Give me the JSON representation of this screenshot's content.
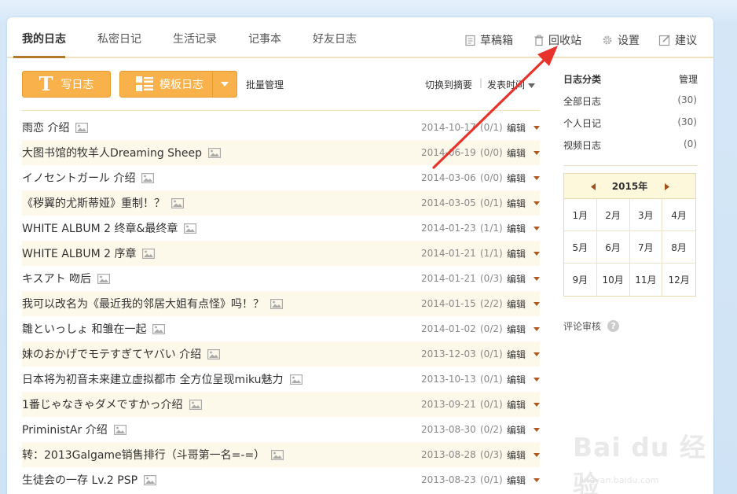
{
  "tabs": [
    {
      "label": "我的日志",
      "active": true
    },
    {
      "label": "私密日记"
    },
    {
      "label": "生活记录"
    },
    {
      "label": "记事本"
    },
    {
      "label": "好友日志"
    }
  ],
  "tools": {
    "drafts": "草稿箱",
    "recycle": "回收站",
    "settings": "设置",
    "suggest": "建议"
  },
  "actions": {
    "write": "写日志",
    "template": "模板日志",
    "batch": "批量管理",
    "switch_view": "切换到摘要",
    "separator": "|",
    "sort": "发表时间"
  },
  "entries": [
    {
      "title": "雨恋 介绍",
      "date": "2014-10-17",
      "count": "(0/1)",
      "edit": "编辑"
    },
    {
      "title": "大图书馆的牧羊人Dreaming Sheep",
      "date": "2014-06-19",
      "count": "(0/0)",
      "edit": "编辑"
    },
    {
      "title": "イノセントガール 介绍",
      "date": "2014-03-06",
      "count": "(0/0)",
      "edit": "编辑"
    },
    {
      "title": "《秽翼的尤斯蒂娅》重制！？",
      "date": "2014-03-05",
      "count": "(0/1)",
      "edit": "编辑"
    },
    {
      "title": "WHITE ALBUM 2 终章&最终章",
      "date": "2014-01-23",
      "count": "(1/1)",
      "edit": "编辑"
    },
    {
      "title": "WHITE ALBUM 2 序章",
      "date": "2014-01-21",
      "count": "(1/1)",
      "edit": "编辑"
    },
    {
      "title": "キスアト 吻后",
      "date": "2014-01-21",
      "count": "(0/3)",
      "edit": "编辑"
    },
    {
      "title": "我可以改名为《最近我的邻居大姐有点怪》吗！？",
      "date": "2014-01-15",
      "count": "(2/2)",
      "edit": "编辑"
    },
    {
      "title": "雛といっしょ 和雏在一起",
      "date": "2014-01-02",
      "count": "(0/2)",
      "edit": "编辑"
    },
    {
      "title": "妹のおかげでモテすぎてヤバい 介绍",
      "date": "2013-12-03",
      "count": "(0/1)",
      "edit": "编辑"
    },
    {
      "title": "日本将为初音未来建立虚拟都市 全方位呈现miku魅力",
      "date": "2013-10-13",
      "count": "(0/1)",
      "edit": "编辑"
    },
    {
      "title": "1番じゃなきゃダメですかっ介绍",
      "date": "2013-09-21",
      "count": "(0/1)",
      "edit": "编辑"
    },
    {
      "title": "PriministAr 介绍",
      "date": "2013-08-30",
      "count": "(0/2)",
      "edit": "编辑"
    },
    {
      "title": "转：2013Galgame销售排行（斗哥第一名=-=）",
      "date": "2013-08-28",
      "count": "(0/3)",
      "edit": "编辑"
    },
    {
      "title": "生徒会の一存 Lv.2 PSP",
      "date": "2013-08-23",
      "count": "(0/1)",
      "edit": "编辑"
    }
  ],
  "sidebar": {
    "title": "日志分类",
    "manage": "管理",
    "categories": [
      {
        "label": "全部日志",
        "count": "(30)"
      },
      {
        "label": "个人日记",
        "count": "(30)"
      },
      {
        "label": "视频日志",
        "count": "(0)"
      }
    ],
    "calendar": {
      "year": "2015年",
      "months": [
        "1月",
        "2月",
        "3月",
        "4月",
        "5月",
        "6月",
        "7月",
        "8月",
        "9月",
        "10月",
        "11月",
        "12月"
      ]
    },
    "review": "评论审核",
    "help": "?"
  },
  "watermark": {
    "text": "Bai du 经验",
    "sub": "jingyan.baidu.com"
  },
  "colors": {
    "accent": "#f9b24b",
    "tab_underline": "#b07a2a",
    "arrow": "#e8322c"
  }
}
